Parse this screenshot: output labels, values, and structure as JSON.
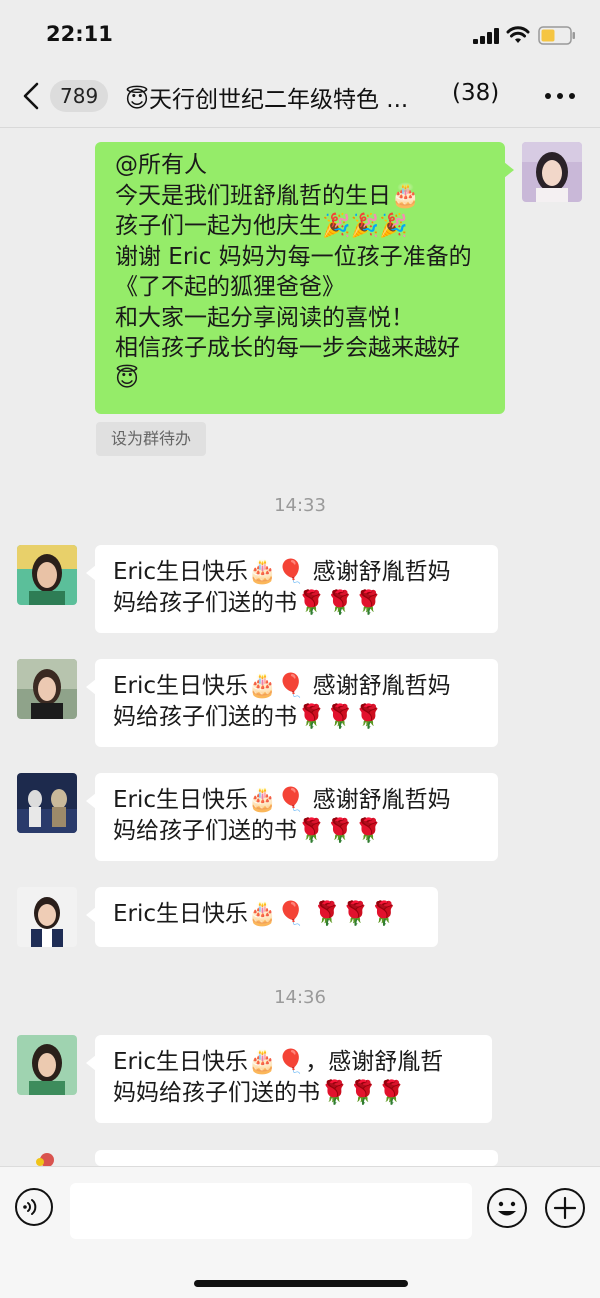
{
  "status": {
    "time": "22:11"
  },
  "nav": {
    "unread": "789",
    "title": "😇天行创世纪二年级特色 ...",
    "member_count": "(38)"
  },
  "messages": {
    "announcement": {
      "lines": [
        "@所有人",
        "今天是我们班舒胤哲的生日🎂",
        "孩子们一起为他庆生🎉🎉🎉",
        "谢谢 Eric 妈妈为每一位孩子准备的",
        "《了不起的狐狸爸爸》",
        "和大家一起分享阅读的喜悦！",
        "相信孩子成长的每一步会越来越好",
        "😇"
      ],
      "todo_label": "设为群待办"
    },
    "time_1": "14:33",
    "msg1": {
      "lines": [
        "Eric生日快乐🎂🎈 感谢舒胤哲妈",
        "妈给孩子们送的书🌹🌹🌹"
      ]
    },
    "msg2": {
      "lines": [
        "Eric生日快乐🎂🎈 感谢舒胤哲妈",
        "妈给孩子们送的书🌹🌹🌹"
      ]
    },
    "msg3": {
      "lines": [
        "Eric生日快乐🎂🎈 感谢舒胤哲妈",
        "妈给孩子们送的书🌹🌹🌹"
      ]
    },
    "msg4": {
      "lines": [
        "Eric生日快乐🎂🎈 🌹🌹🌹"
      ]
    },
    "time_2": "14:36",
    "msg5": {
      "lines": [
        "Eric生日快乐🎂🎈，感谢舒胤哲",
        "妈妈给孩子们送的书🌹🌹🌹"
      ]
    }
  },
  "colors": {
    "my_bubble": "#95ec69",
    "other_bubble": "#ffffff",
    "background": "#ededed"
  },
  "icons": [
    "signal-icon",
    "wifi-icon",
    "battery-icon",
    "back-chevron-icon",
    "more-icon",
    "voice-icon",
    "emoji-icon",
    "add-icon"
  ]
}
